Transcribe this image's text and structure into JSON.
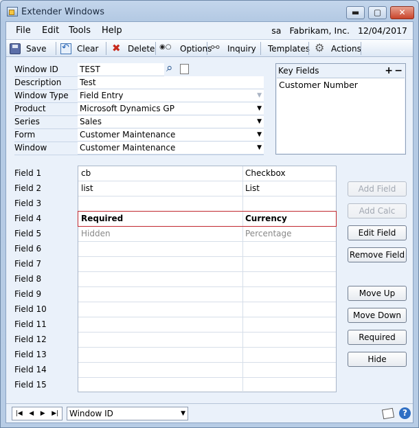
{
  "window": {
    "title": "Extender Windows",
    "minimize": "▬",
    "maximize": "▢",
    "close": "✕"
  },
  "menu": {
    "items": [
      "File",
      "Edit",
      "Tools",
      "Help"
    ],
    "user": "sa",
    "company": "Fabrikam, Inc.",
    "date": "12/04/2017"
  },
  "toolbar": {
    "save": "Save",
    "clear": "Clear",
    "delete": "Delete",
    "options": "Options",
    "inquiry": "Inquiry",
    "templates": "Templates",
    "actions": "Actions"
  },
  "form": {
    "window_id_label": "Window ID",
    "window_id": "TEST",
    "description_label": "Description",
    "description": "Test",
    "window_type_label": "Window Type",
    "window_type": "Field Entry",
    "product_label": "Product",
    "product": "Microsoft Dynamics GP",
    "series_label": "Series",
    "series": "Sales",
    "form_label": "Form",
    "form": "Customer Maintenance",
    "window_label": "Window",
    "window": "Customer Maintenance"
  },
  "key_fields": {
    "title": "Key Fields",
    "add": "+",
    "remove": "−",
    "items": [
      "Customer Number"
    ]
  },
  "fields": [
    {
      "label": "Field 1",
      "name": "cb",
      "type": "Checkbox"
    },
    {
      "label": "Field 2",
      "name": "list",
      "type": "List"
    },
    {
      "label": "Field 3",
      "name": "",
      "type": ""
    },
    {
      "label": "Field 4",
      "name": "Required",
      "type": "Currency"
    },
    {
      "label": "Field 5",
      "name": "Hidden",
      "type": "Percentage"
    },
    {
      "label": "Field 6",
      "name": "",
      "type": ""
    },
    {
      "label": "Field 7",
      "name": "",
      "type": ""
    },
    {
      "label": "Field 8",
      "name": "",
      "type": ""
    },
    {
      "label": "Field 9",
      "name": "",
      "type": ""
    },
    {
      "label": "Field 10",
      "name": "",
      "type": ""
    },
    {
      "label": "Field 11",
      "name": "",
      "type": ""
    },
    {
      "label": "Field 12",
      "name": "",
      "type": ""
    },
    {
      "label": "Field 13",
      "name": "",
      "type": ""
    },
    {
      "label": "Field 14",
      "name": "",
      "type": ""
    },
    {
      "label": "Field 15",
      "name": "",
      "type": ""
    }
  ],
  "side_buttons": {
    "add_field": "Add Field",
    "add_calc": "Add Calc",
    "edit_field": "Edit Field",
    "remove_field": "Remove Field",
    "move_up": "Move Up",
    "move_down": "Move Down",
    "required": "Required",
    "hide": "Hide"
  },
  "bottom": {
    "sort_by": "Window ID"
  },
  "colors": {
    "selected_row_border": "#c0262d",
    "title_bar": "#b7cce5"
  }
}
